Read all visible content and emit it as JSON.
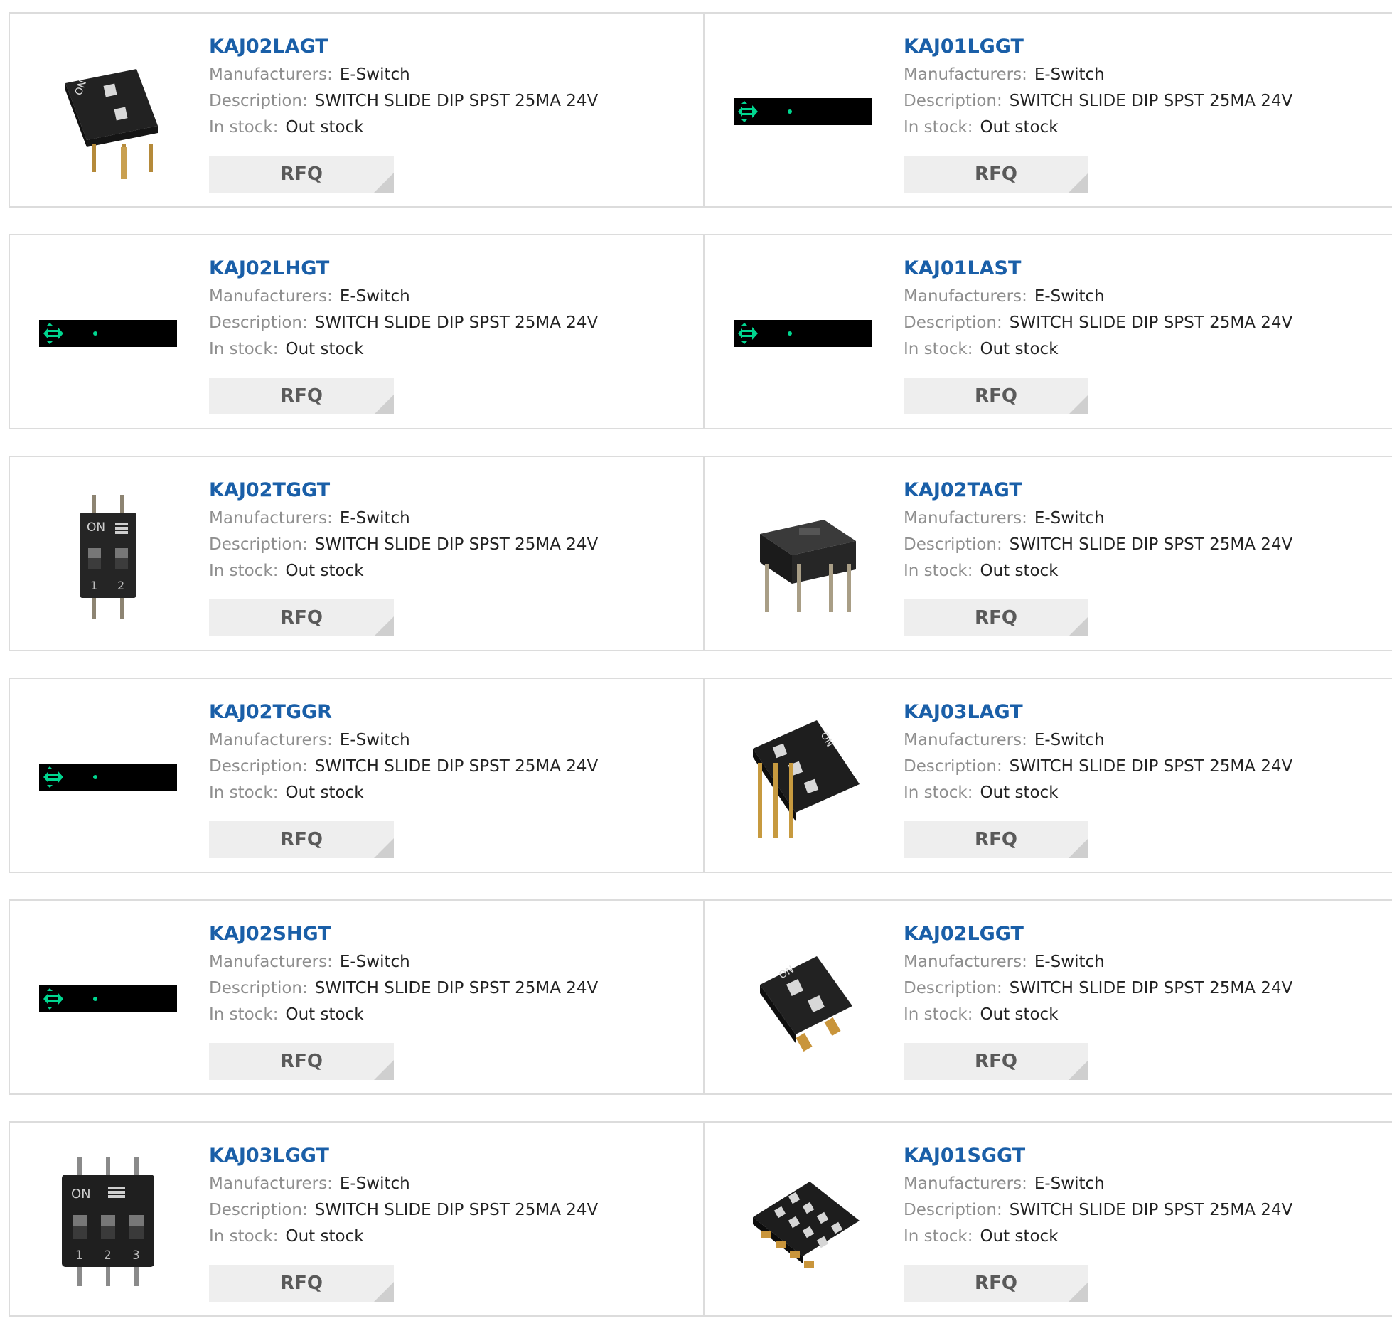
{
  "colors": {
    "part_link": "#1a5fa8",
    "label": "#8e8e8e",
    "value": "#222222",
    "rfq_bg": "#eeeeee",
    "rfq_text": "#5a5a5a",
    "border": "#dcdcdc",
    "placeholder_accent": "#00d68f"
  },
  "products": [
    {
      "part": "KAJ02LAGT",
      "image": "dip-switch-2pos-angled-photo",
      "manufacturers_label": "Manufacturers:",
      "manufacturer": "E-Switch",
      "description_label": "Description:",
      "description": "SWITCH SLIDE DIP SPST 25MA 24V",
      "stock_label": "In stock:",
      "stock": "Out stock",
      "rfq_label": "RFQ"
    },
    {
      "part": "KAJ01LGGT",
      "image": "image-placeholder-strip",
      "manufacturers_label": "Manufacturers:",
      "manufacturer": "E-Switch",
      "description_label": "Description:",
      "description": "SWITCH SLIDE DIP SPST 25MA 24V",
      "stock_label": "In stock:",
      "stock": "Out stock",
      "rfq_label": "RFQ"
    },
    {
      "part": "KAJ02LHGT",
      "image": "image-placeholder-strip",
      "manufacturers_label": "Manufacturers:",
      "manufacturer": "E-Switch",
      "description_label": "Description:",
      "description": "SWITCH SLIDE DIP SPST 25MA 24V",
      "stock_label": "In stock:",
      "stock": "Out stock",
      "rfq_label": "RFQ"
    },
    {
      "part": "KAJ01LAST",
      "image": "image-placeholder-strip",
      "manufacturers_label": "Manufacturers:",
      "manufacturer": "E-Switch",
      "description_label": "Description:",
      "description": "SWITCH SLIDE DIP SPST 25MA 24V",
      "stock_label": "In stock:",
      "stock": "Out stock",
      "rfq_label": "RFQ"
    },
    {
      "part": "KAJ02TGGT",
      "image": "dip-switch-2pos-top-view-photo",
      "manufacturers_label": "Manufacturers:",
      "manufacturer": "E-Switch",
      "description_label": "Description:",
      "description": "SWITCH SLIDE DIP SPST 25MA 24V",
      "stock_label": "In stock:",
      "stock": "Out stock",
      "rfq_label": "RFQ"
    },
    {
      "part": "KAJ02TAGT",
      "image": "dip-switch-2pos-side-photo",
      "manufacturers_label": "Manufacturers:",
      "manufacturer": "E-Switch",
      "description_label": "Description:",
      "description": "SWITCH SLIDE DIP SPST 25MA 24V",
      "stock_label": "In stock:",
      "stock": "Out stock",
      "rfq_label": "RFQ"
    },
    {
      "part": "KAJ02TGGR",
      "image": "image-placeholder-strip",
      "manufacturers_label": "Manufacturers:",
      "manufacturer": "E-Switch",
      "description_label": "Description:",
      "description": "SWITCH SLIDE DIP SPST 25MA 24V",
      "stock_label": "In stock:",
      "stock": "Out stock",
      "rfq_label": "RFQ"
    },
    {
      "part": "KAJ03LAGT",
      "image": "dip-switch-3pos-angled-photo",
      "manufacturers_label": "Manufacturers:",
      "manufacturer": "E-Switch",
      "description_label": "Description:",
      "description": "SWITCH SLIDE DIP SPST 25MA 24V",
      "stock_label": "In stock:",
      "stock": "Out stock",
      "rfq_label": "RFQ"
    },
    {
      "part": "KAJ02SHGT",
      "image": "image-placeholder-strip",
      "manufacturers_label": "Manufacturers:",
      "manufacturer": "E-Switch",
      "description_label": "Description:",
      "description": "SWITCH SLIDE DIP SPST 25MA 24V",
      "stock_label": "In stock:",
      "stock": "Out stock",
      "rfq_label": "RFQ"
    },
    {
      "part": "KAJ02LGGT",
      "image": "dip-switch-2pos-smd-photo",
      "manufacturers_label": "Manufacturers:",
      "manufacturer": "E-Switch",
      "description_label": "Description:",
      "description": "SWITCH SLIDE DIP SPST 25MA 24V",
      "stock_label": "In stock:",
      "stock": "Out stock",
      "rfq_label": "RFQ"
    },
    {
      "part": "KAJ03LGGT",
      "image": "dip-switch-3pos-top-view-photo",
      "manufacturers_label": "Manufacturers:",
      "manufacturer": "E-Switch",
      "description_label": "Description:",
      "description": "SWITCH SLIDE DIP SPST 25MA 24V",
      "stock_label": "In stock:",
      "stock": "Out stock",
      "rfq_label": "RFQ"
    },
    {
      "part": "KAJ01SGGT",
      "image": "dip-switch-4pos-smd-photo",
      "manufacturers_label": "Manufacturers:",
      "manufacturer": "E-Switch",
      "description_label": "Description:",
      "description": "SWITCH SLIDE DIP SPST 25MA 24V",
      "stock_label": "In stock:",
      "stock": "Out stock",
      "rfq_label": "RFQ"
    }
  ]
}
